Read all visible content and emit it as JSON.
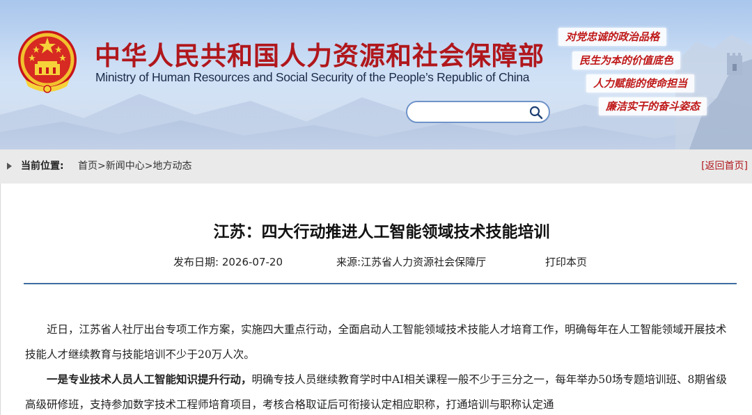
{
  "header": {
    "title_cn": "中华人民共和国人力资源和社会保障部",
    "title_en": "Ministry of Human Resources and Social Security of the People’s Republic of China",
    "search_placeholder": "",
    "slogans": [
      "对党忠诚的政治品格",
      "民生为本的价值底色",
      "人力赋能的使命担当",
      "廉洁实干的奋斗姿态"
    ],
    "colors": {
      "title_red": "#b0171c",
      "banner_blue": "#a9c6ec"
    }
  },
  "breadcrumb": {
    "label": "当前位置:",
    "items": [
      "首页",
      "新闻中心",
      "地方动态"
    ],
    "separator": ">",
    "back_home": "[返回首页]"
  },
  "article": {
    "title": "江苏：四大行动推进人工智能领域技术技能培训",
    "date_label": "发布日期:",
    "date": "2026-07-20",
    "source_label": "来源:",
    "source": "江苏省人力资源社会保障厅",
    "print": "打印本页",
    "para1": "近日，江苏省人社厅出台专项工作方案，实施四大重点行动，全面启动人工智能领域技术技能人才培育工作，明确每年在人工智能领域开展技术技能人才继续教育与技能培训不少于20万人次。",
    "para2_bold": "一是专业技术人员人工智能知识提升行动，",
    "para2_rest": "明确专技人员继续教育学时中AI相关课程一般不少于三分之一，每年举办50场专题培训班、8期省级高级研修班，支持参加数字技术工程师培育项目，考核合格取证后可衔接认定相应职称，打通培训与职称认定通"
  }
}
